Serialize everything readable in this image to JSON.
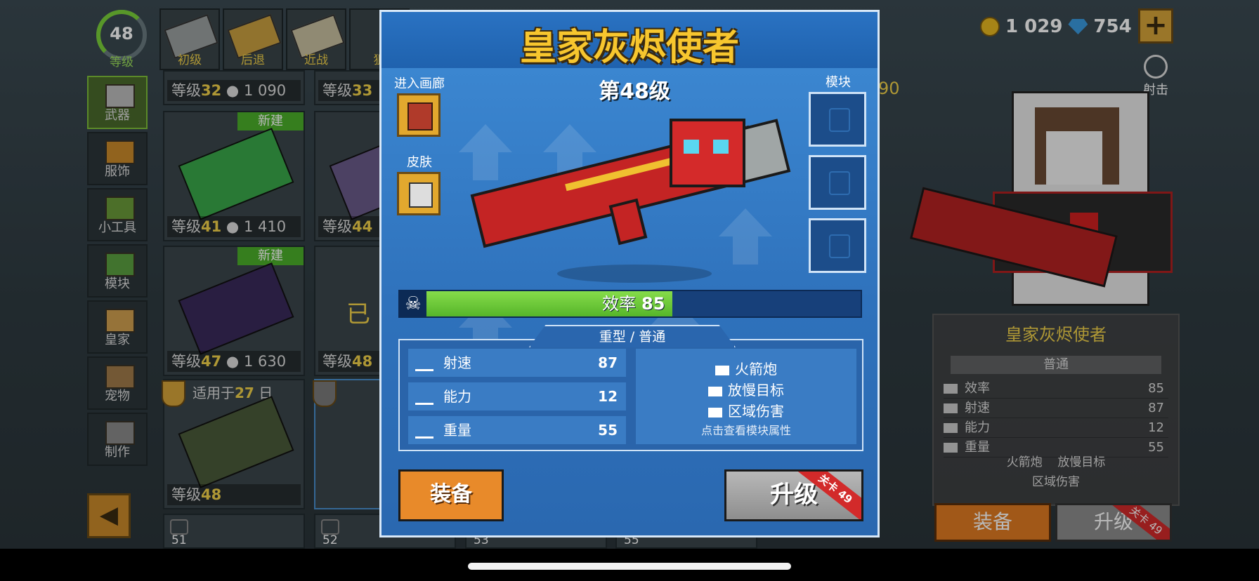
{
  "player": {
    "level": "48",
    "level_label": "等级"
  },
  "currency": {
    "coins": "1 029",
    "gems": "754"
  },
  "top_tabs": [
    "初级",
    "后退",
    "近战",
    "狙"
  ],
  "sidebar": [
    "武器",
    "服饰",
    "小工具",
    "模块",
    "皇家",
    "宠物",
    "制作"
  ],
  "cards": [
    {
      "level": "32",
      "price": "1 090"
    },
    {
      "level": "33",
      "price": ""
    },
    {
      "badge": "新建",
      "level": "41",
      "price": "1 410"
    },
    {
      "level": "44",
      "price": ""
    },
    {
      "badge": "新建",
      "level": "47",
      "price": "1 630"
    },
    {
      "level": "48",
      "price": ""
    },
    {
      "until_prefix": "适用于",
      "until_days": "27",
      "until_suffix": "日",
      "level": "48"
    }
  ],
  "card_level_prefix": "等级",
  "card_partial_text": "已",
  "locked_levels": [
    "51",
    "52",
    "53",
    "55"
  ],
  "right_price_partial": "90",
  "shoot_label": "射击",
  "modal": {
    "title": "皇家灰烬使者",
    "gallery_label": "进入画廊",
    "skin_label": "皮肤",
    "level_text": "第48级",
    "modules_label": "模块",
    "efficiency_label": "效率",
    "efficiency_value": "85",
    "category": "重型 / 普通",
    "stats": [
      {
        "name": "射速",
        "value": "87"
      },
      {
        "name": "能力",
        "value": "12"
      },
      {
        "name": "重量",
        "value": "55"
      }
    ],
    "modules": [
      "火箭炮",
      "放慢目标",
      "区域伤害"
    ],
    "module_hint": "点击查看模块属性",
    "equip_label": "装备",
    "upgrade_label": "升级",
    "upgrade_ribbon": "关卡 49"
  },
  "side_info": {
    "name": "皇家灰烬使者",
    "category": "普通",
    "stats": [
      {
        "name": "效率",
        "value": "85"
      },
      {
        "name": "射速",
        "value": "87"
      },
      {
        "name": "能力",
        "value": "12"
      },
      {
        "name": "重量",
        "value": "55"
      }
    ],
    "modules": [
      "火箭炮",
      "放慢目标",
      "区域伤害"
    ],
    "equip_label": "装备",
    "upgrade_label": "升级",
    "upgrade_ribbon": "关卡 49"
  },
  "colors": {
    "modal_bg": "#2f72bc",
    "title": "#f7c62e",
    "efficiency_fill": "#6cc83a",
    "equip": "#e88a2a"
  },
  "efficiency_fraction": 0.85
}
